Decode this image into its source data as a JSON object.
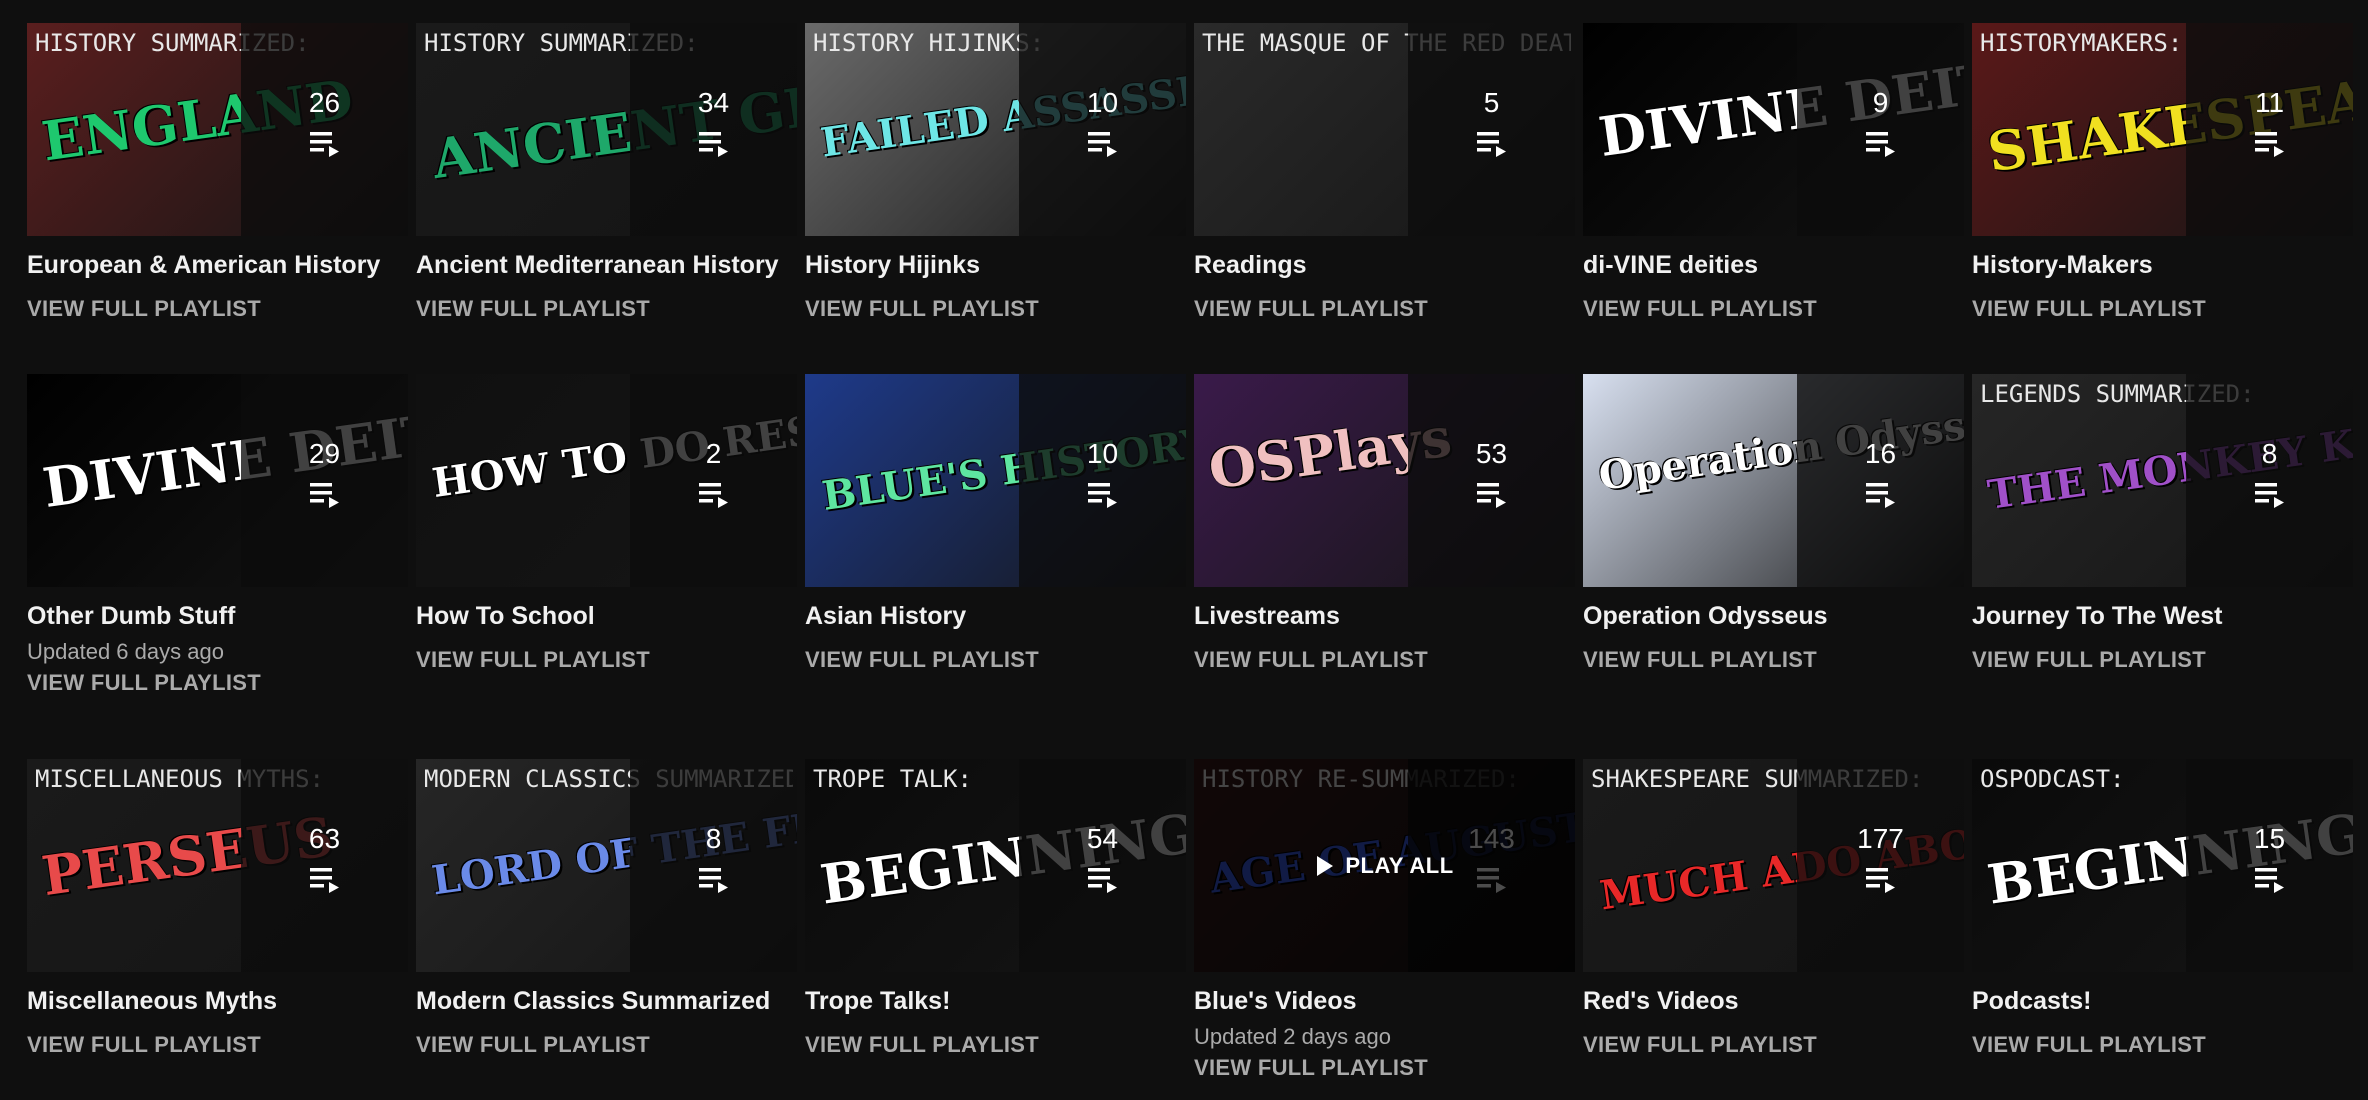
{
  "playlists": [
    {
      "title": "European & American History",
      "count": "26",
      "updated": "",
      "view_label": "VIEW FULL PLAYLIST",
      "art": {
        "top": "HISTORY SUMMARIZED:",
        "main": "ENGLAND",
        "bg": "#5a1e1e",
        "fg": "#1ec86e",
        "overlay_bg": "#3a3a3a"
      }
    },
    {
      "title": "Ancient Mediterranean History",
      "count": "34",
      "updated": "",
      "view_label": "VIEW FULL PLAYLIST",
      "art": {
        "top": "HISTORY SUMMARIZED:",
        "main": "ANCIENT GREECE",
        "bg": "#1a1a1a",
        "fg": "#1ea86a",
        "overlay_bg": "#2a2a2a"
      }
    },
    {
      "title": "History Hijinks",
      "count": "10",
      "updated": "",
      "view_label": "VIEW FULL PLAYLIST",
      "art": {
        "top": "HISTORY HIJINKS:",
        "main": "FAILED ASSASSINS",
        "bg": "#6a6a6a",
        "fg": "#6ee6e6",
        "overlay_bg": "#4a4a4a"
      }
    },
    {
      "title": "Readings",
      "count": "5",
      "updated": "",
      "view_label": "VIEW FULL PLAYLIST",
      "art": {
        "top": "THE MASQUE OF THE RED DEATH",
        "main": "",
        "bg": "#2a2a2a",
        "fg": "#e83030",
        "overlay_bg": "#222"
      }
    },
    {
      "title": "di-VINE deities",
      "count": "9",
      "updated": "",
      "view_label": "VIEW FULL PLAYLIST",
      "art": {
        "top": "",
        "main": "DIVINE DEITIES",
        "bg": "#000000",
        "fg": "#ffffff",
        "overlay_bg": "#111"
      }
    },
    {
      "title": "History-Makers",
      "count": "11",
      "updated": "",
      "view_label": "VIEW FULL PLAYLIST",
      "art": {
        "top": "HISTORYMAKERS:",
        "main": "SHAKESPEARE",
        "bg": "#5a1818",
        "fg": "#f0e020",
        "overlay_bg": "#3a2a2a"
      }
    },
    {
      "title": "Other Dumb Stuff",
      "count": "29",
      "updated": "Updated 6 days ago",
      "view_label": "VIEW FULL PLAYLIST",
      "art": {
        "top": "",
        "main": "DIVINE DEITIES",
        "bg": "#000000",
        "fg": "#ffffff",
        "overlay_bg": "#111"
      }
    },
    {
      "title": "How To School",
      "count": "2",
      "updated": "",
      "view_label": "VIEW FULL PLAYLIST",
      "art": {
        "top": "",
        "main": "HOW TO DO RESEARCH",
        "bg": "#101010",
        "fg": "#ffffff",
        "overlay_bg": "#1a1a1a"
      }
    },
    {
      "title": "Asian History",
      "count": "10",
      "updated": "",
      "view_label": "VIEW FULL PLAYLIST",
      "art": {
        "top": "",
        "main": "BLUE'S HISTORY SUMMARIZED",
        "bg": "#1e3a8a",
        "fg": "#5ee6a0",
        "overlay_bg": "#3a3a3a"
      }
    },
    {
      "title": "Livestreams",
      "count": "53",
      "updated": "",
      "view_label": "VIEW FULL PLAYLIST",
      "art": {
        "top": "",
        "main": "OSPlays",
        "bg": "#3a1a4a",
        "fg": "#f0c0c0",
        "overlay_bg": "#1e2a4a"
      }
    },
    {
      "title": "Operation Odysseus",
      "count": "16",
      "updated": "",
      "view_label": "VIEW FULL PLAYLIST",
      "art": {
        "top": "",
        "main": "Operation Odysseus",
        "bg": "#d8e0f0",
        "fg": "#ffffff",
        "overlay_bg": "#556"
      }
    },
    {
      "title": "Journey To The West",
      "count": "8",
      "updated": "",
      "view_label": "VIEW FULL PLAYLIST",
      "art": {
        "top": "LEGENDS SUMMARIZED:",
        "main": "THE MONKEY KING",
        "bg": "#262626",
        "fg": "#a050c8",
        "overlay_bg": "#2a2a2a"
      }
    },
    {
      "title": "Miscellaneous Myths",
      "count": "63",
      "updated": "",
      "view_label": "VIEW FULL PLAYLIST",
      "art": {
        "top": "MISCELLANEOUS MYTHS:",
        "main": "PERSEUS",
        "bg": "#1a1a1a",
        "fg": "#e84a4a",
        "overlay_bg": "#2a2a2a"
      }
    },
    {
      "title": "Modern Classics Summarized",
      "count": "8",
      "updated": "",
      "view_label": "VIEW FULL PLAYLIST",
      "art": {
        "top": "MODERN CLASSICS SUMMARIZED:",
        "main": "LORD OF THE FLIES",
        "bg": "#262626",
        "fg": "#6a8ae8",
        "overlay_bg": "#2a2a2a"
      }
    },
    {
      "title": "Trope Talks!",
      "count": "54",
      "updated": "",
      "view_label": "VIEW FULL PLAYLIST",
      "art": {
        "top": "TROPE TALK:",
        "main": "BEGINNINGS",
        "bg": "#0a0a0a",
        "fg": "#ffffff",
        "overlay_bg": "#1a1a1a"
      }
    },
    {
      "title": "Blue's Videos",
      "count": "143",
      "updated": "Updated 2 days ago",
      "view_label": "VIEW FULL PLAYLIST",
      "play_all": "PLAY ALL",
      "art": {
        "top": "HISTORY RE-SUMMARIZED:",
        "main": "AGE OF AUGUSTUS",
        "bg": "#3a1a1a",
        "fg": "#3a5ae8",
        "overlay_bg": "#2a2a2a"
      }
    },
    {
      "title": "Red's Videos",
      "count": "177",
      "updated": "",
      "view_label": "VIEW FULL PLAYLIST",
      "art": {
        "top": "SHAKESPEARE SUMMARIZED:",
        "main": "MUCH ADO ABOUT NOTHING",
        "bg": "#1a1a1a",
        "fg": "#e82828",
        "overlay_bg": "#2a2a2a"
      }
    },
    {
      "title": "Podcasts!",
      "count": "15",
      "updated": "",
      "view_label": "VIEW FULL PLAYLIST",
      "art": {
        "top": "OSPODCAST:",
        "main": "BEGINNINGS",
        "bg": "#0a0a0a",
        "fg": "#ffffff",
        "overlay_bg": "#1a1a1a"
      }
    }
  ]
}
